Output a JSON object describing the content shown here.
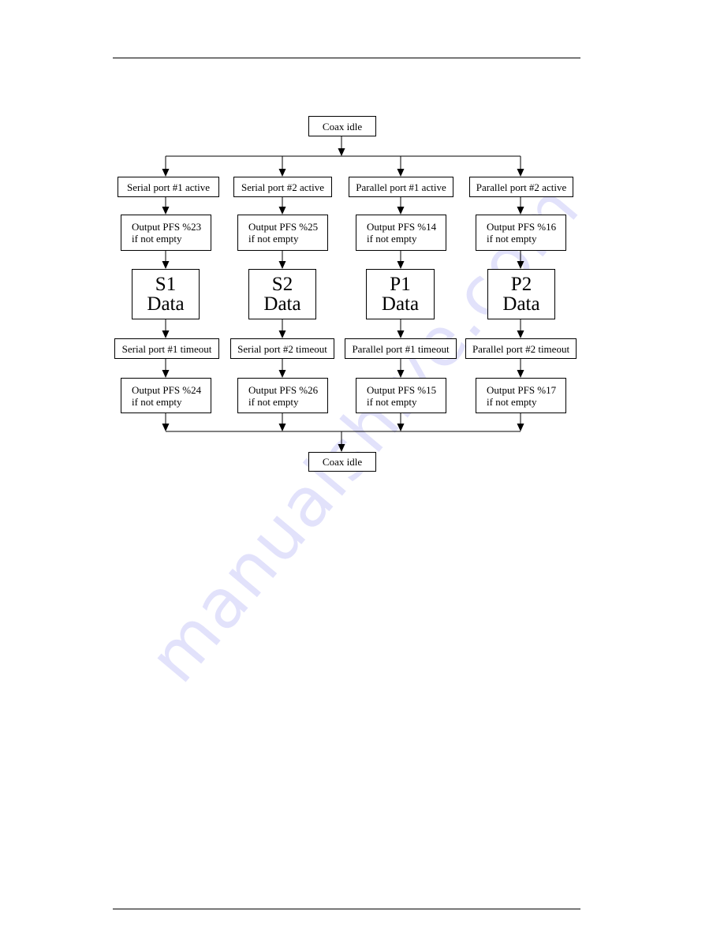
{
  "page": {
    "watermark": "manualshive.com"
  },
  "diagram": {
    "start": "Coax idle",
    "end": "Coax idle",
    "columns": [
      {
        "id": "S1",
        "active": "Serial port #1 active",
        "output_start": [
          "Output PFS %23",
          "if not empty"
        ],
        "data": [
          "S1",
          "Data"
        ],
        "timeout": "Serial port #1 timeout",
        "output_end": [
          "Output PFS %24",
          "if not empty"
        ]
      },
      {
        "id": "S2",
        "active": "Serial port #2 active",
        "output_start": [
          "Output PFS %25",
          "if not empty"
        ],
        "data": [
          "S2",
          "Data"
        ],
        "timeout": "Serial port #2 timeout",
        "output_end": [
          "Output PFS %26",
          "if not empty"
        ]
      },
      {
        "id": "P1",
        "active": "Parallel port #1 active",
        "output_start": [
          "Output PFS %14",
          "if not empty"
        ],
        "data": [
          "P1",
          "Data"
        ],
        "timeout": "Parallel port #1 timeout",
        "output_end": [
          "Output PFS %15",
          "if not empty"
        ]
      },
      {
        "id": "P2",
        "active": "Parallel port #2 active",
        "output_start": [
          "Output PFS %16",
          "if not empty"
        ],
        "data": [
          "P2",
          "Data"
        ],
        "timeout": "Parallel port #2 timeout",
        "output_end": [
          "Output PFS %17",
          "if not empty"
        ]
      }
    ]
  }
}
